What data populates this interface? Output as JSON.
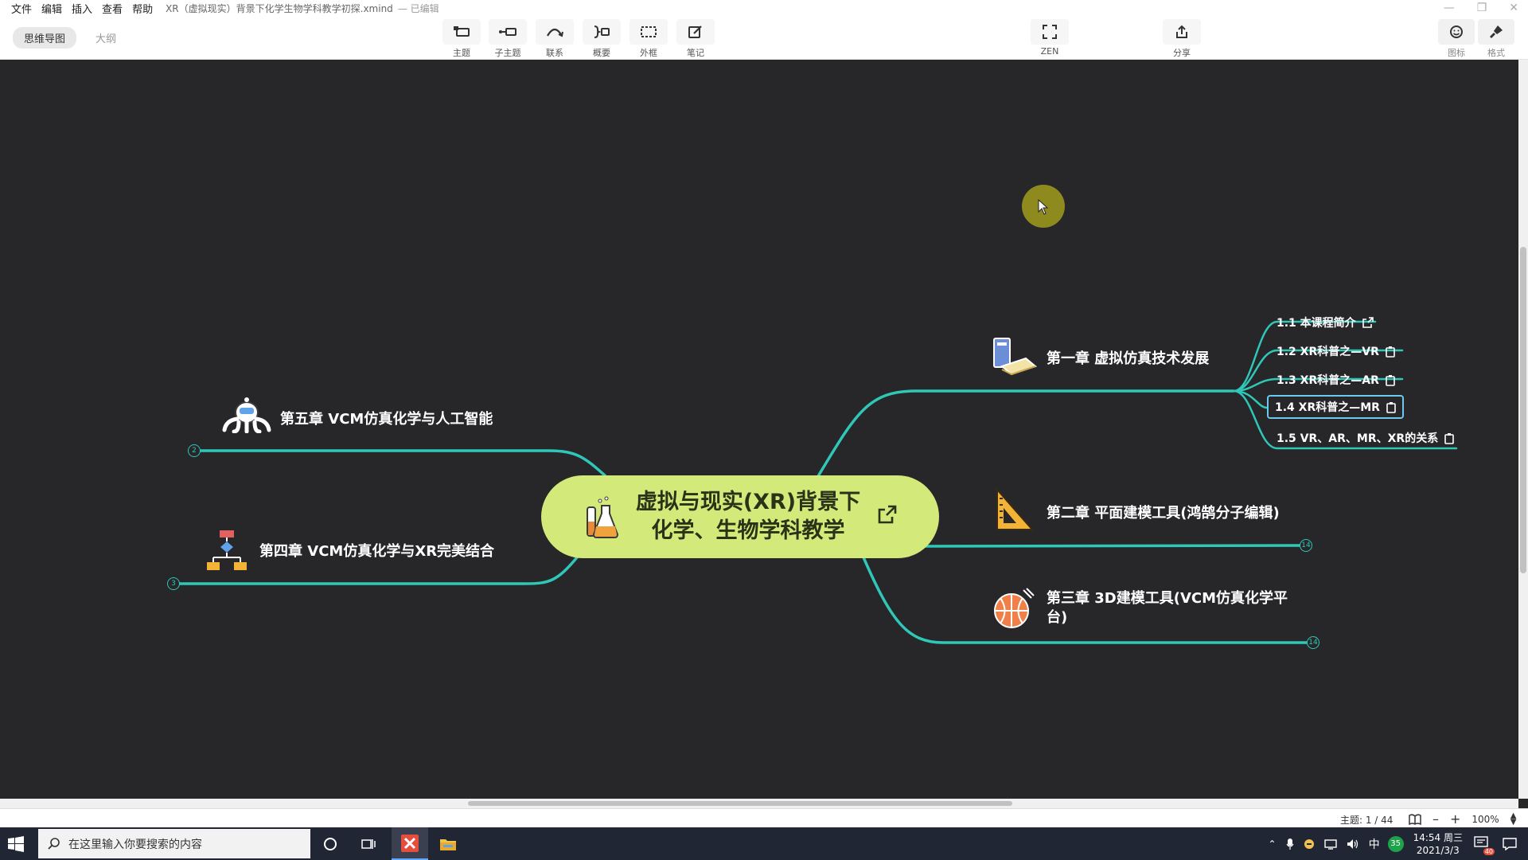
{
  "app": {
    "menu": [
      "文件",
      "编辑",
      "插入",
      "查看",
      "帮助"
    ],
    "doc_title": "XR（虚拟现实）背景下化学生物学科教学初探.xmind",
    "doc_state": "— 已编辑"
  },
  "toolbar": {
    "view_tabs": [
      "思维导图",
      "大纲"
    ],
    "tools": [
      "主题",
      "子主题",
      "联系",
      "概要",
      "外框",
      "笔记"
    ],
    "zen_label": "ZEN",
    "share_label": "分享",
    "icons_label": "图标",
    "format_label": "格式"
  },
  "mindmap": {
    "central": "虚拟与现实(XR)背景下化学、生物学科教学",
    "chapters": [
      {
        "label": "第一章  虚拟仿真技术发展",
        "icon": "book-icon"
      },
      {
        "label": "第二章  平面建模工具(鸿鹄分子编辑)",
        "icon": "triangle-ruler-icon",
        "badge": "14"
      },
      {
        "label": "第三章  3D建模工具(VCM仿真化学平台)",
        "icon": "basketball-icon",
        "badge": "14"
      },
      {
        "label": "第四章  VCM仿真化学与XR完美结合",
        "icon": "flowchart-icon",
        "badge": "3"
      },
      {
        "label": "第五章  VCM仿真化学与人工智能",
        "icon": "robot-icon",
        "badge": "2"
      }
    ],
    "subtopics": [
      {
        "label": "1.1  本课程简介",
        "icon": "external-link-icon"
      },
      {
        "label": "1.2  XR科普之—VR",
        "icon": "note-icon"
      },
      {
        "label": "1.3  XR科普之—AR",
        "icon": "note-icon"
      },
      {
        "label": "1.4  XR科普之—MR",
        "icon": "note-icon",
        "selected": true
      },
      {
        "label": "1.5  VR、AR、MR、XR的关系",
        "icon": "note-icon"
      }
    ],
    "branch_color": "#2fc7b8",
    "central_color": "#d3ea7a",
    "background": "#272629"
  },
  "status": {
    "topic_count": "主题: 1 / 44",
    "zoom": "100%"
  },
  "taskbar": {
    "search_placeholder": "在这里输入你要搜索的内容",
    "ime": "中",
    "weather": "35",
    "time": "14:54 周三",
    "date": "2021/3/3",
    "notification_count": "40"
  }
}
